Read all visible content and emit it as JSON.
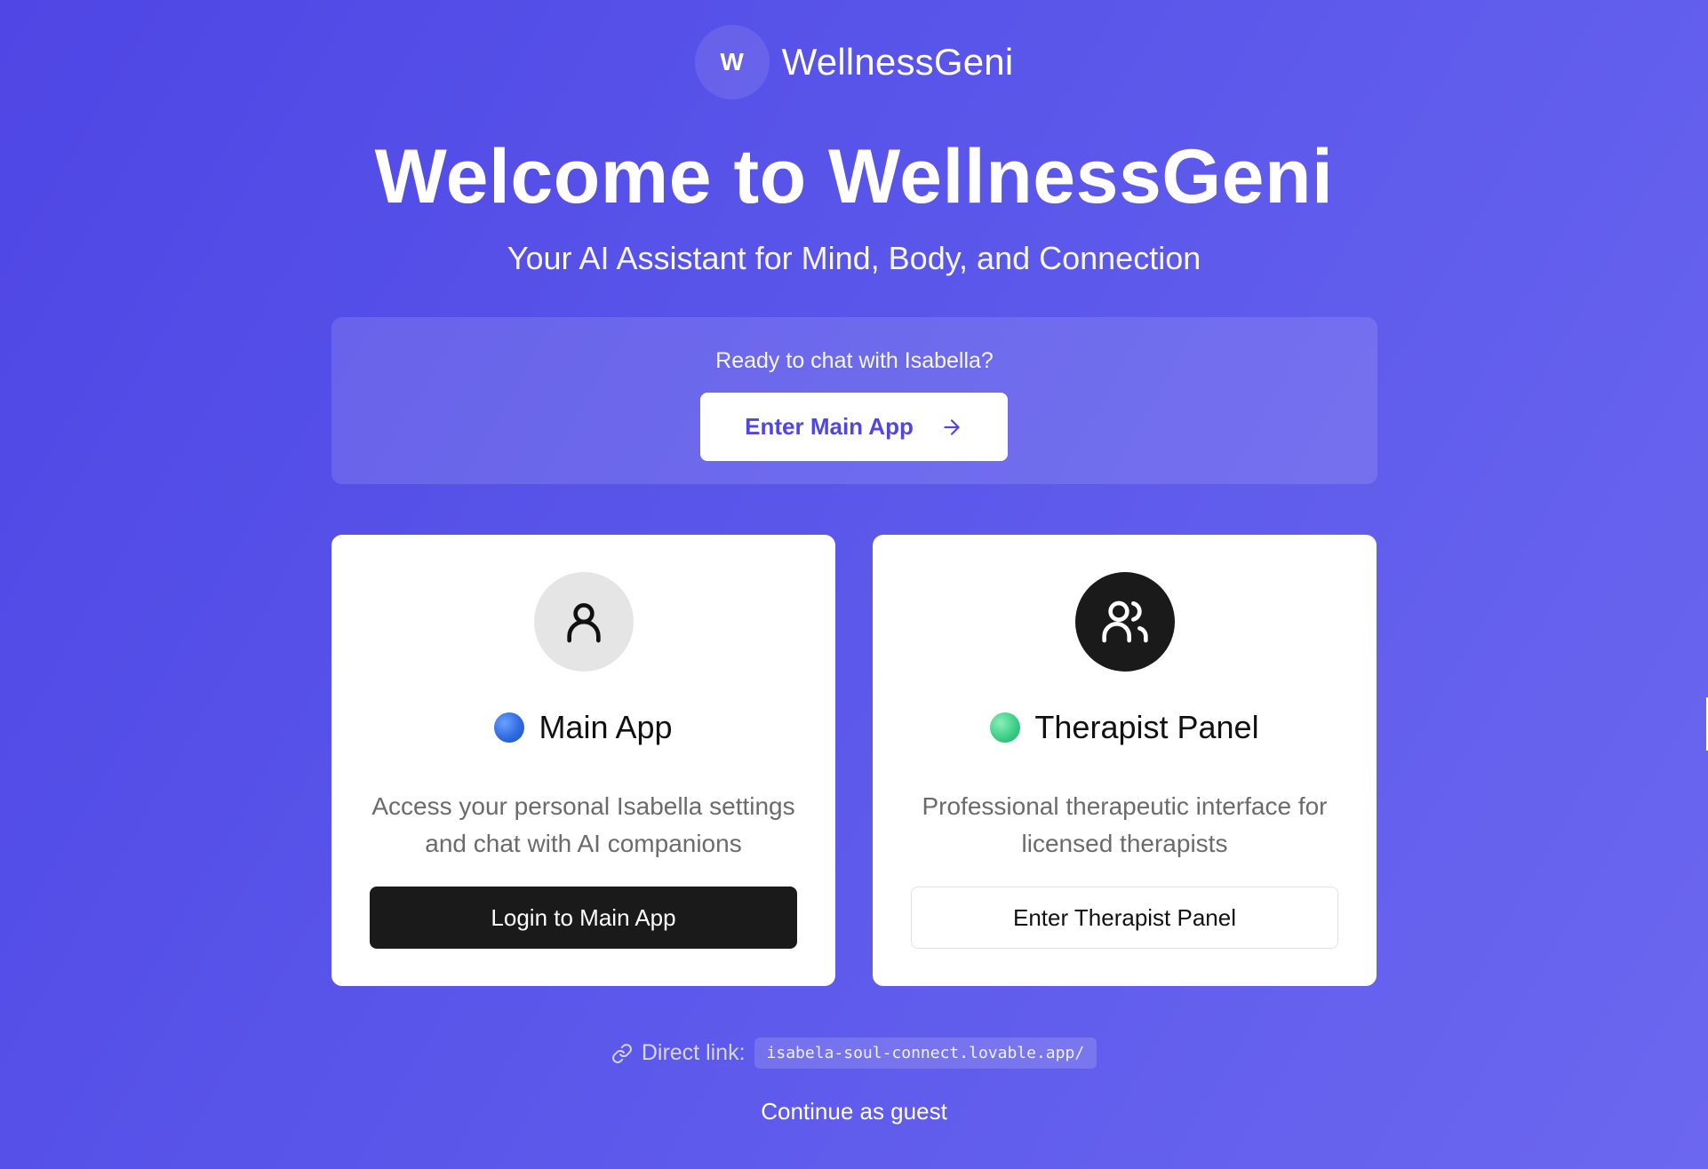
{
  "brand": {
    "logo_letter": "W",
    "name": "WellnessGeni"
  },
  "hero": {
    "title": "Welcome to WellnessGeni",
    "subtitle": "Your AI Assistant for Mind, Body, and Connection"
  },
  "cta": {
    "prompt": "Ready to chat with Isabella?",
    "button_label": "Enter Main App",
    "button_icon": "arrow-right-icon"
  },
  "cards": [
    {
      "icon": "user-icon",
      "dot_color": "#2f6be0",
      "title": "Main App",
      "description": "Access your personal Isabella settings and chat with AI companions",
      "button_label": "Login to Main App"
    },
    {
      "icon": "users-icon",
      "dot_color": "#3ccf86",
      "title": "Therapist Panel",
      "description": "Professional therapeutic interface for licensed therapists",
      "button_label": "Enter Therapist Panel"
    }
  ],
  "footer": {
    "link_icon": "link-icon",
    "direct_label": "Direct link:",
    "direct_url": "isabela-soul-connect.lovable.app/",
    "guest_label": "Continue as guest"
  },
  "colors": {
    "background_start": "#4f46e5",
    "background_end": "#6c67f0",
    "accent": "#4f46e5",
    "dark_button": "#1a1a1a"
  }
}
